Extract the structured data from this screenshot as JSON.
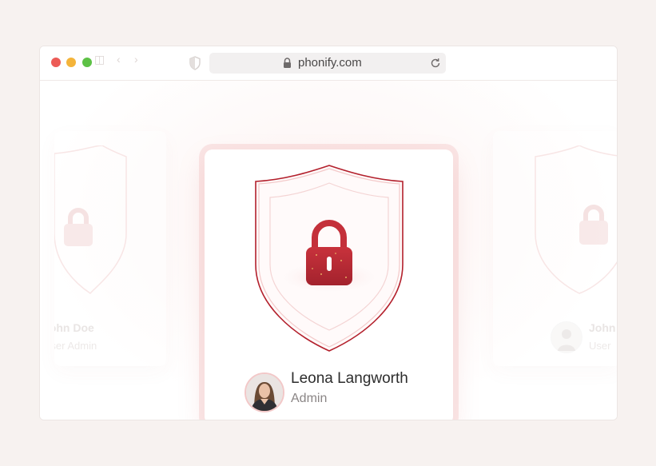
{
  "browser": {
    "url": "phonify.com",
    "icons": [
      "close-dot",
      "minimize-dot",
      "maximize-dot",
      "sidebar-icon",
      "back-icon",
      "forward-icon",
      "shield-icon",
      "lock-icon",
      "reload-icon"
    ]
  },
  "cards": {
    "left": {
      "name": "John Doe",
      "role": "User Admin"
    },
    "main": {
      "name": "Leona Langworth",
      "role": "Admin"
    },
    "right": {
      "name": "John",
      "role": "User"
    }
  },
  "colors": {
    "accent": "#c8323c",
    "page_background": "#f7f2f0"
  }
}
